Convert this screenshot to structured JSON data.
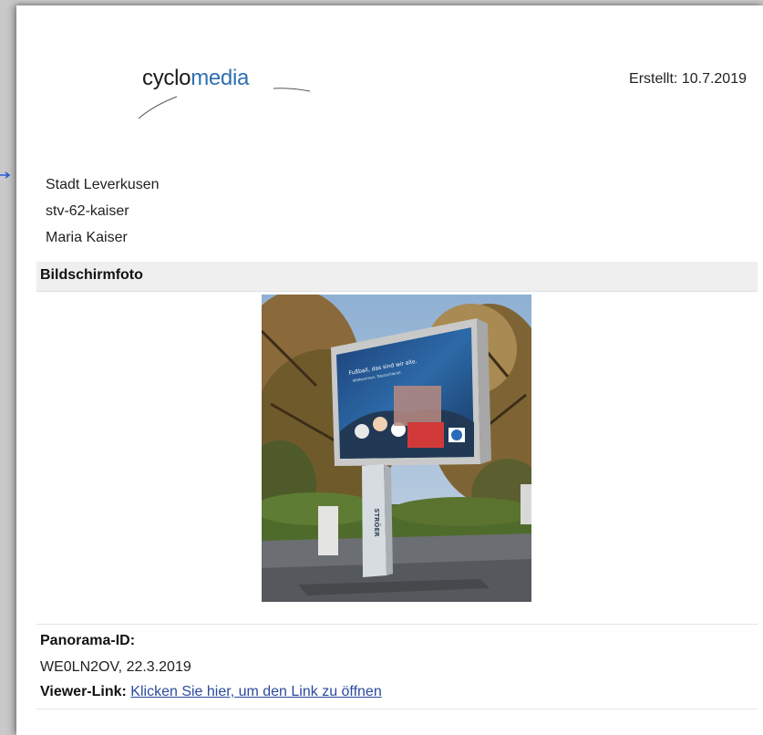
{
  "header": {
    "logo_part1": "cyclo",
    "logo_part2": "media",
    "created": "Erstellt: 10.7.2019"
  },
  "address": {
    "line1": "Stadt Leverkusen",
    "line2": "stv-62-kaiser",
    "line3": "Maria Kaiser"
  },
  "screenshot_section": {
    "title": "Bildschirmfoto"
  },
  "billboard": {
    "headline": "Fußball, das sind wir alle.",
    "subline": "Willkommen, Deutschland!",
    "pole_brand": "STRÖER"
  },
  "panorama": {
    "id_label": "Panorama-ID:",
    "id_value": "WE0LN2OV, 22.3.2019",
    "viewer_label": "Viewer-Link:",
    "viewer_link": "Klicken Sie hier, um den Link zu öffnen"
  },
  "colors": {
    "brand_blue": "#2f6fae",
    "link": "#2b4a9e",
    "section_bg": "#efefef"
  }
}
